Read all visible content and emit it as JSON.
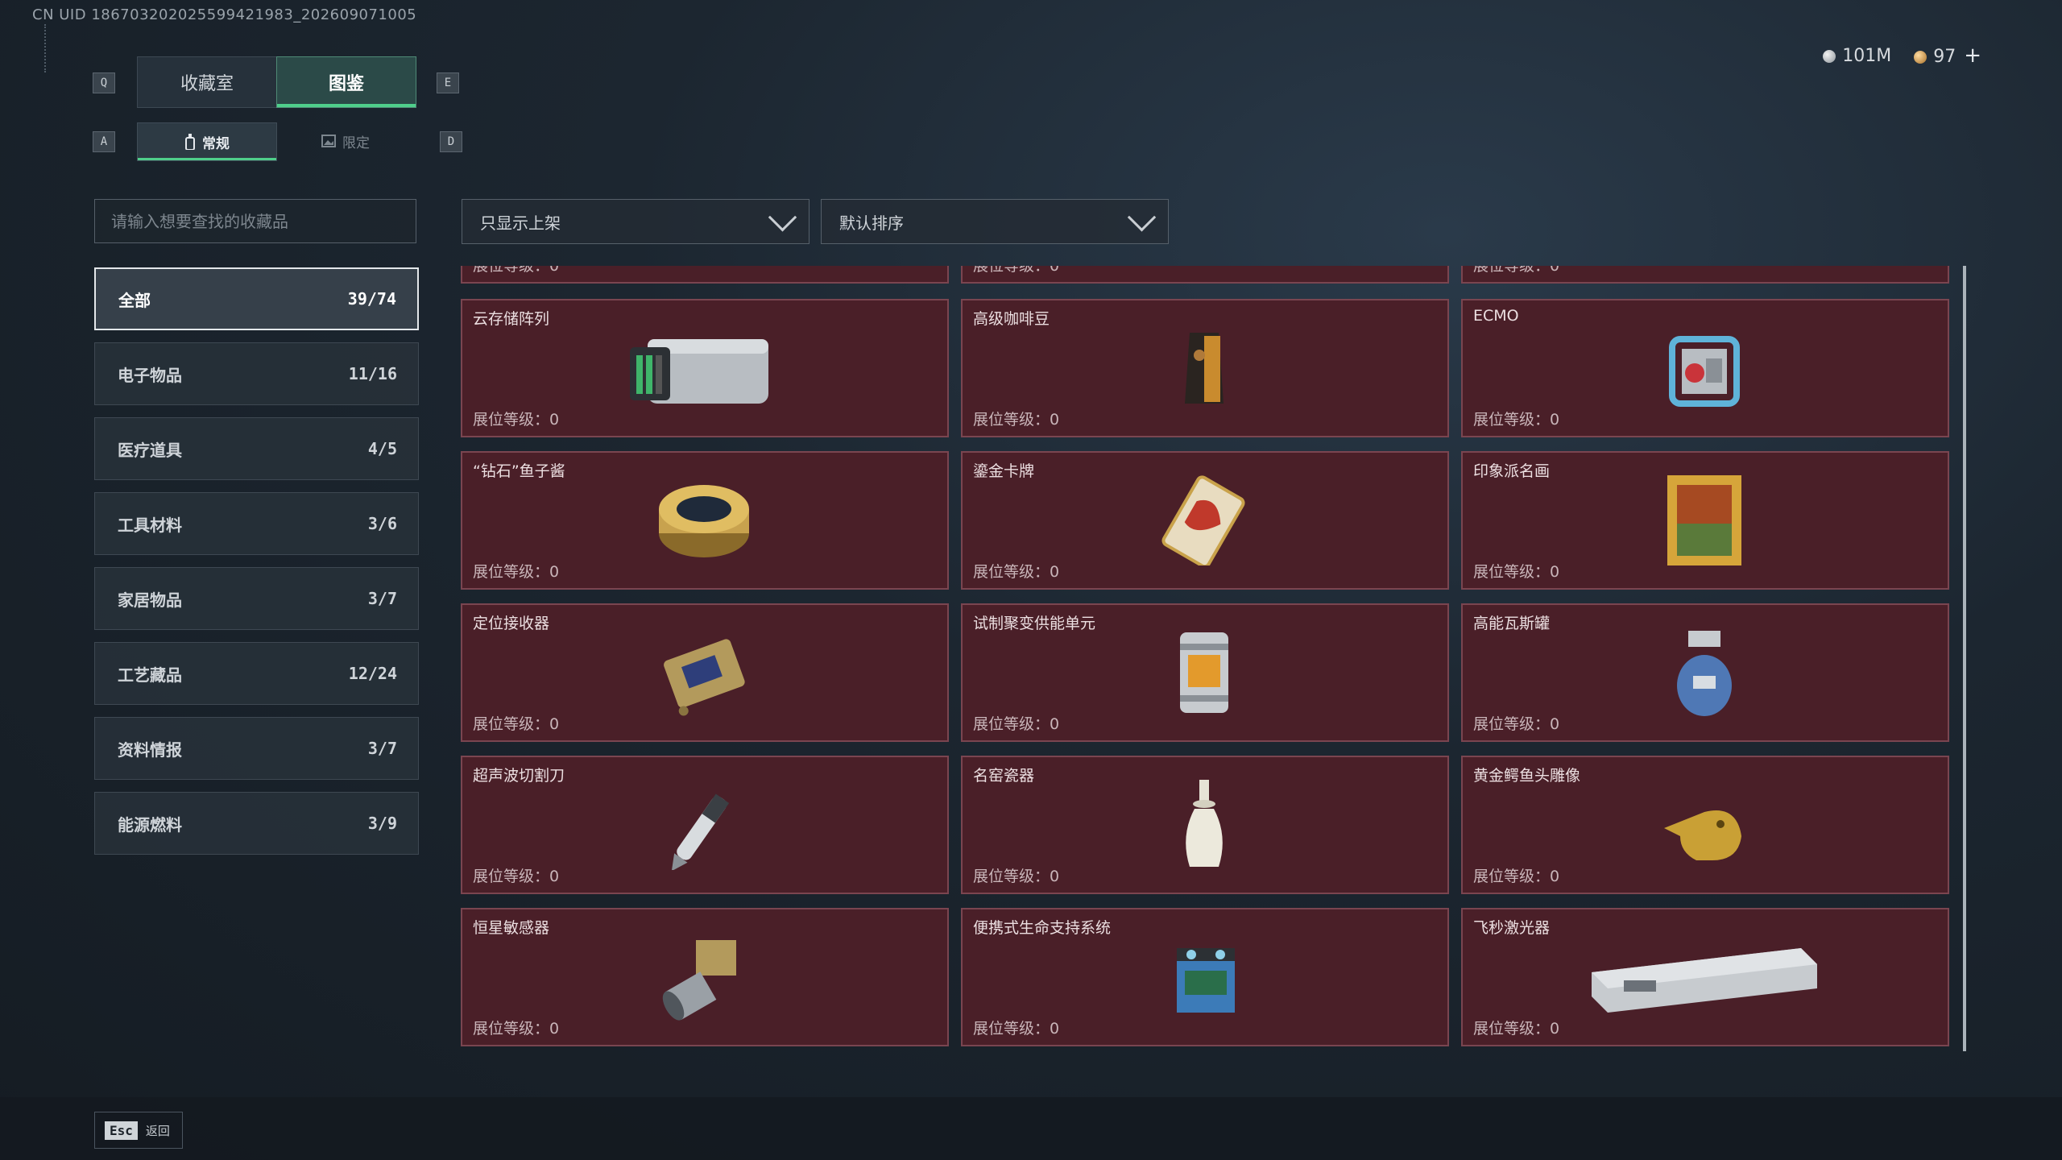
{
  "uid_text": "CN UID 1867032020255994219​83_202609071005",
  "keys": {
    "q": "Q",
    "e": "E",
    "a": "A",
    "d": "D"
  },
  "tabs_main": [
    "收藏室",
    "图鉴"
  ],
  "tabs_sub": [
    "常规",
    "限定"
  ],
  "currency": {
    "silver": "101M",
    "gold": "97",
    "plus": "+"
  },
  "search": {
    "placeholder": "请输入想要查找的收藏品"
  },
  "filters": {
    "display": "只显示上架",
    "sort": "默认排序"
  },
  "categories": [
    {
      "label": "全部",
      "count": "39/74"
    },
    {
      "label": "电子物品",
      "count": "11/16"
    },
    {
      "label": "医疗道具",
      "count": "4/5"
    },
    {
      "label": "工具材料",
      "count": "3/6"
    },
    {
      "label": "家居物品",
      "count": "3/7"
    },
    {
      "label": "工艺藏品",
      "count": "12/24"
    },
    {
      "label": "资料情报",
      "count": "3/7"
    },
    {
      "label": "能源燃料",
      "count": "3/9"
    }
  ],
  "level_text": "展位等级：0",
  "items": [
    {
      "name": "",
      "icon": "partial-item-icon"
    },
    {
      "name": "",
      "icon": "partial-item-icon"
    },
    {
      "name": "",
      "icon": "partial-item-icon"
    },
    {
      "name": "云存储阵列",
      "icon": "server-array-icon"
    },
    {
      "name": "高级咖啡豆",
      "icon": "coffee-bag-icon"
    },
    {
      "name": "ECMO",
      "icon": "ecmo-machine-icon"
    },
    {
      "name": "“钻石”鱼子酱",
      "icon": "caviar-tin-icon"
    },
    {
      "name": "鎏金卡牌",
      "icon": "gold-card-icon"
    },
    {
      "name": "印象派名画",
      "icon": "framed-painting-icon"
    },
    {
      "name": "定位接收器",
      "icon": "gps-receiver-icon"
    },
    {
      "name": "试制聚变供能单元",
      "icon": "fusion-cell-icon"
    },
    {
      "name": "高能瓦斯罐",
      "icon": "gas-canister-icon"
    },
    {
      "name": "超声波切割刀",
      "icon": "ultrasonic-cutter-icon"
    },
    {
      "name": "名窑瓷器",
      "icon": "porcelain-vase-icon"
    },
    {
      "name": "黄金鳄鱼头雕像",
      "icon": "gold-crocodile-icon"
    },
    {
      "name": "恒星敏感器",
      "icon": "star-sensor-icon"
    },
    {
      "name": "便携式生命支持系统",
      "icon": "life-support-icon"
    },
    {
      "name": "飞秒激光器",
      "icon": "laser-case-icon"
    }
  ],
  "esc": {
    "key": "Esc",
    "label": "返回"
  }
}
